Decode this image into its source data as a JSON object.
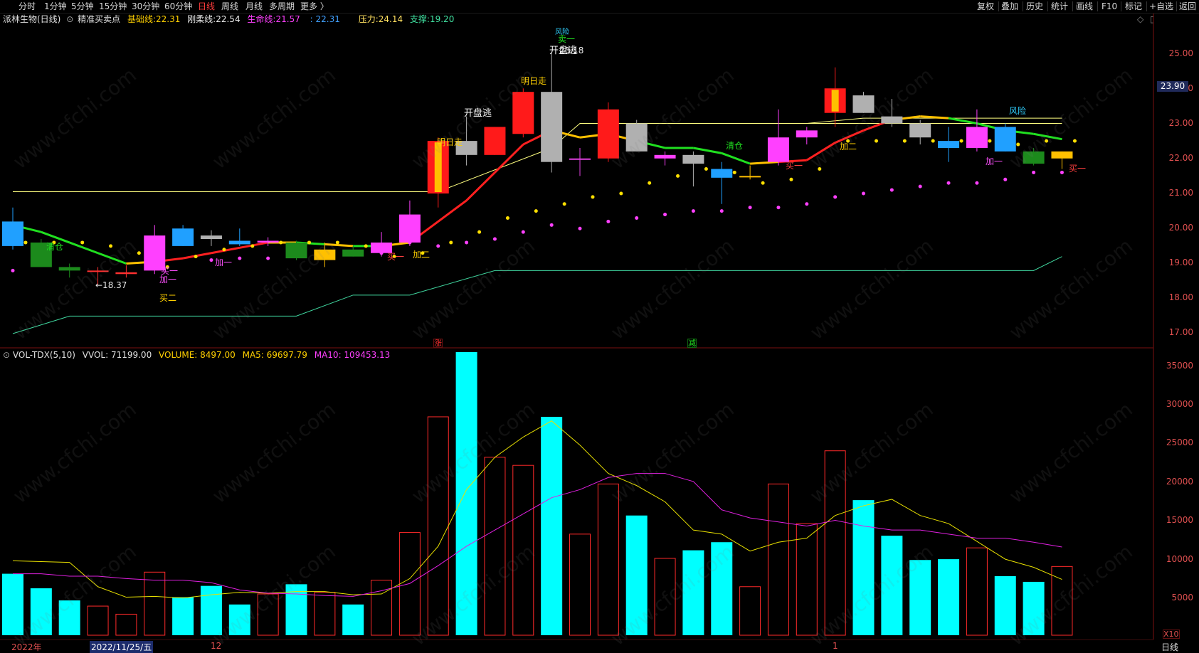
{
  "toolbar": {
    "periods": [
      "分时",
      "1分钟",
      "5分钟",
      "15分钟",
      "30分钟",
      "60分钟",
      "日线",
      "周线",
      "月线",
      "多周期",
      "更多 〉"
    ],
    "active_period": "日线",
    "right_buttons": [
      "复权",
      "叠加",
      "历史",
      "统计",
      "画线",
      "F10",
      "标记",
      "+自选",
      "返回"
    ]
  },
  "title": {
    "stock": "派林生物(日线)",
    "indicator": "精准买卖点",
    "base_label": "基础线:",
    "base_value": "22.31",
    "firm_label": "刚柔线:",
    "firm_value": "22.54",
    "life_label": "生命线:",
    "life_value": "21.57",
    "extra_value": ": 22.31",
    "pressure_label": "压力:",
    "pressure_value": "24.14",
    "support_label": "支撑:",
    "support_value": "19.20"
  },
  "vol_title": {
    "name": "VOL-TDX(5,10)",
    "vvol": "VVOL: 71199.00",
    "volume": "VOLUME: 8497.00",
    "ma5": "MA5: 69697.79",
    "ma10": "MA10: 109453.13"
  },
  "price_axis": [
    "25.00",
    "24.00",
    "23.00",
    "22.00",
    "21.00",
    "20.00",
    "19.00",
    "18.00",
    "17.00"
  ],
  "current_price_tag": "23.90",
  "vol_axis": [
    "35000",
    "30000",
    "25000",
    "20000",
    "15000",
    "10000",
    "5000"
  ],
  "vol_unit": "X10",
  "date_labels": [
    "2022年",
    "2022/11/25/五",
    "12",
    "1"
  ],
  "footer_right": "日线",
  "markers": {
    "zhang": "涨",
    "jian": "减",
    "low_price": "←18.37",
    "high_price": "23.18"
  },
  "annotations": [
    {
      "text": "清仓",
      "kind": "green"
    },
    {
      "text": "买二",
      "kind": "yellow"
    },
    {
      "text": "买一",
      "kind": "pink"
    },
    {
      "text": "加一",
      "kind": "pink"
    },
    {
      "text": "加一",
      "kind": "pink"
    },
    {
      "text": "买一",
      "kind": "pink"
    },
    {
      "text": "加二",
      "kind": "yellow"
    },
    {
      "text": "明日走",
      "kind": "yellow"
    },
    {
      "text": "开盘逃",
      "kind": "white"
    },
    {
      "text": "明日走",
      "kind": "yellow"
    },
    {
      "text": "开盘逃",
      "kind": "white"
    },
    {
      "text": "卖一",
      "kind": "green"
    },
    {
      "text": "风险",
      "kind": "cyan"
    },
    {
      "text": "清仓",
      "kind": "green"
    },
    {
      "text": "买一",
      "kind": "pink"
    },
    {
      "text": "加二",
      "kind": "yellow"
    },
    {
      "text": "风险",
      "kind": "cyan"
    },
    {
      "text": "加一",
      "kind": "pink"
    },
    {
      "text": "买一",
      "kind": "pink"
    }
  ],
  "watermark": "www.cfchi.com",
  "colors": {
    "up": "#ff2a2a",
    "down": "#00ffff",
    "ma5": "#e8e000",
    "ma10": "#e020e0",
    "support": "#40d8a0",
    "pressure": "#ffff80"
  },
  "chart_data": {
    "type": "candlestick",
    "ylim": [
      16.8,
      25.4
    ],
    "candles": [
      {
        "o": 20.2,
        "h": 20.6,
        "l": 19.4,
        "c": 19.5,
        "col": "#20a0ff"
      },
      {
        "o": 19.6,
        "h": 19.7,
        "l": 18.9,
        "c": 18.9,
        "col": "#1c8a1c"
      },
      {
        "o": 18.9,
        "h": 19.0,
        "l": 18.6,
        "c": 18.8,
        "col": "#1c8a1c"
      },
      {
        "o": 18.8,
        "h": 18.9,
        "l": 18.4,
        "c": 18.8,
        "col": "#ff3030"
      },
      {
        "o": 18.75,
        "h": 18.95,
        "l": 18.6,
        "c": 18.7,
        "col": "#ff3030"
      },
      {
        "o": 18.8,
        "h": 20.1,
        "l": 18.7,
        "c": 19.8,
        "col": "#ff40ff"
      },
      {
        "o": 20.0,
        "h": 20.1,
        "l": 19.5,
        "c": 19.5,
        "col": "#20a0ff"
      },
      {
        "o": 19.8,
        "h": 19.95,
        "l": 19.5,
        "c": 19.7,
        "col": "#b0b0b0"
      },
      {
        "o": 19.65,
        "h": 20.0,
        "l": 19.5,
        "c": 19.55,
        "col": "#20a0ff"
      },
      {
        "o": 19.6,
        "h": 19.75,
        "l": 19.5,
        "c": 19.65,
        "col": "#ff40ff"
      },
      {
        "o": 19.6,
        "h": 19.65,
        "l": 19.1,
        "c": 19.15,
        "col": "#1c8a1c"
      },
      {
        "o": 19.1,
        "h": 19.6,
        "l": 18.9,
        "c": 19.4,
        "col": "#ffc000"
      },
      {
        "o": 19.4,
        "h": 19.5,
        "l": 19.2,
        "c": 19.2,
        "col": "#1c8a1c"
      },
      {
        "o": 19.3,
        "h": 19.9,
        "l": 19.2,
        "c": 19.6,
        "col": "#ff40ff"
      },
      {
        "o": 19.6,
        "h": 20.8,
        "l": 19.5,
        "c": 20.4,
        "col": "#ff40ff"
      },
      {
        "o": 21.0,
        "h": 22.6,
        "l": 20.6,
        "c": 22.5,
        "col": "#ff1a1a",
        "inner": "#ffc000"
      },
      {
        "o": 22.5,
        "h": 23.2,
        "l": 21.8,
        "c": 22.1,
        "col": "#b0b0b0"
      },
      {
        "o": 22.1,
        "h": 22.9,
        "l": 22.1,
        "c": 22.9,
        "col": "#ff1a1a"
      },
      {
        "o": 22.7,
        "h": 24.0,
        "l": 22.6,
        "c": 23.9,
        "col": "#ff1a1a"
      },
      {
        "o": 23.9,
        "h": 25.0,
        "l": 21.6,
        "c": 21.9,
        "col": "#b0b0b0"
      },
      {
        "o": 22.0,
        "h": 22.3,
        "l": 21.5,
        "c": 22.0,
        "col": "#e040e0"
      },
      {
        "o": 23.4,
        "h": 23.6,
        "l": 21.9,
        "c": 22.0,
        "col": "#ff1a1a"
      },
      {
        "o": 23.0,
        "h": 23.1,
        "l": 22.2,
        "c": 22.2,
        "col": "#b0b0b0"
      },
      {
        "o": 22.1,
        "h": 22.2,
        "l": 21.8,
        "c": 22.0,
        "col": "#ff40ff"
      },
      {
        "o": 22.1,
        "h": 22.2,
        "l": 21.2,
        "c": 21.85,
        "col": "#b0b0b0"
      },
      {
        "o": 21.7,
        "h": 21.9,
        "l": 20.7,
        "c": 21.45,
        "col": "#20a0ff"
      },
      {
        "o": 21.5,
        "h": 21.8,
        "l": 21.4,
        "c": 21.5,
        "col": "#ffc000"
      },
      {
        "o": 21.9,
        "h": 23.4,
        "l": 21.8,
        "c": 22.6,
        "col": "#ff40ff"
      },
      {
        "o": 22.6,
        "h": 22.9,
        "l": 22.4,
        "c": 22.8,
        "col": "#ff40ff"
      },
      {
        "o": 23.3,
        "h": 24.6,
        "l": 22.9,
        "c": 24.0,
        "col": "#ff1a1a",
        "inner": "#ffc000"
      },
      {
        "o": 23.8,
        "h": 23.9,
        "l": 23.3,
        "c": 23.3,
        "col": "#b0b0b0"
      },
      {
        "o": 23.2,
        "h": 23.7,
        "l": 22.9,
        "c": 23.0,
        "col": "#b0b0b0"
      },
      {
        "o": 23.0,
        "h": 23.1,
        "l": 22.4,
        "c": 22.6,
        "col": "#b0b0b0"
      },
      {
        "o": 22.5,
        "h": 22.9,
        "l": 21.9,
        "c": 22.3,
        "col": "#20a0ff"
      },
      {
        "o": 22.3,
        "h": 23.4,
        "l": 22.2,
        "c": 22.9,
        "col": "#ff40ff"
      },
      {
        "o": 22.9,
        "h": 23.0,
        "l": 22.2,
        "c": 22.2,
        "col": "#20a0ff"
      },
      {
        "o": 22.2,
        "h": 22.3,
        "l": 21.8,
        "c": 21.85,
        "col": "#1c8a1c"
      },
      {
        "o": 22.0,
        "h": 22.2,
        "l": 21.7,
        "c": 22.2,
        "col": "#ffc000"
      }
    ],
    "volumes": [
      7600,
      5800,
      4300,
      3600,
      2600,
      7800,
      4700,
      6100,
      3800,
      5100,
      6300,
      5300,
      3800,
      6800,
      12700,
      27000,
      35000,
      22000,
      21000,
      27000,
      12500,
      18700,
      14800,
      9500,
      10500,
      11500,
      6000,
      18700,
      13800,
      22800,
      16700,
      12300,
      9300,
      9400,
      10800,
      7300,
      6600,
      8500
    ],
    "vol_up": [
      false,
      false,
      false,
      true,
      true,
      true,
      false,
      false,
      false,
      true,
      false,
      true,
      false,
      true,
      true,
      true,
      false,
      true,
      true,
      false,
      true,
      true,
      false,
      true,
      false,
      false,
      true,
      true,
      true,
      true,
      false,
      false,
      false,
      false,
      true,
      false,
      false,
      true
    ],
    "vol_ma5": [
      9200,
      9100,
      9000,
      6000,
      4700,
      4800,
      4600,
      5000,
      5300,
      5200,
      5400,
      5400,
      5000,
      5100,
      7000,
      11000,
      18000,
      22000,
      24500,
      26500,
      23500,
      20000,
      18500,
      16500,
      13000,
      12500,
      10400,
      11500,
      12000,
      14800,
      16000,
      16800,
      14800,
      13800,
      11600,
      9400,
      8400,
      6900
    ],
    "vol_ma10": [
      7600,
      7600,
      7300,
      7300,
      7000,
      6800,
      6800,
      6500,
      5600,
      5200,
      5100,
      4900,
      4800,
      5500,
      6400,
      8600,
      11000,
      13000,
      15000,
      17000,
      18000,
      19500,
      20000,
      20000,
      19000,
      15500,
      14500,
      14000,
      13500,
      14200,
      13500,
      13000,
      13000,
      12500,
      12000,
      12000,
      11500,
      10900
    ],
    "base_line": [
      20.1,
      19.9,
      19.6,
      19.3,
      19.0,
      19.05,
      19.15,
      19.3,
      19.45,
      19.6,
      19.6,
      19.55,
      19.5,
      19.5,
      19.6,
      20.2,
      20.8,
      21.6,
      22.4,
      22.8,
      22.6,
      22.7,
      22.5,
      22.3,
      22.3,
      22.15,
      21.85,
      21.9,
      21.95,
      22.45,
      22.8,
      23.1,
      23.2,
      23.15,
      23.0,
      22.8,
      22.7,
      22.55
    ],
    "line_colors": [
      "#20e020",
      "#20e020",
      "#20e020",
      "#20e020",
      "#ffc000",
      "#ff2020",
      "#ff2020",
      "#ff2020",
      "#ff2020",
      "#ffc000",
      "#20e020",
      "#ffc000",
      "#20e020",
      "#ffc000",
      "#ff2020",
      "#ff2020",
      "#ff2020",
      "#ff2020",
      "#ff2020",
      "#ffc000",
      "#ffc000",
      "#ffc000",
      "#20e020",
      "#20e020",
      "#20e020",
      "#20e020",
      "#ffc000",
      "#ff2020",
      "#ff2020",
      "#ff2020",
      "#ff2020",
      "#ffc000",
      "#ffc000",
      "#20e020",
      "#20e020",
      "#20e020",
      "#20e020",
      "#ffc000"
    ],
    "pressure_steps": [
      [
        0,
        21.05
      ],
      [
        14,
        21.05
      ],
      [
        15,
        21.05
      ],
      [
        19,
        22.3
      ],
      [
        20,
        23.0
      ],
      [
        37,
        23.0
      ]
    ],
    "pressure2": [
      [
        28,
        23.0
      ],
      [
        30,
        23.15
      ],
      [
        37,
        23.15
      ]
    ],
    "support_steps": [
      [
        0,
        17.0
      ],
      [
        2,
        17.5
      ],
      [
        10,
        17.5
      ],
      [
        12,
        18.1
      ],
      [
        14,
        18.1
      ],
      [
        17,
        18.8
      ],
      [
        36,
        18.8
      ],
      [
        37,
        19.2
      ]
    ],
    "yellow_dots": [
      19.6,
      19.6,
      19.6,
      19.5,
      19.3,
      18.9,
      19.2,
      19.4,
      19.5,
      19.6,
      19.6,
      19.6,
      19.5,
      19.2,
      19.3,
      19.6,
      19.9,
      20.3,
      20.5,
      20.7,
      20.9,
      21.0,
      21.3,
      21.5,
      21.7,
      21.6,
      21.3,
      21.4,
      21.7,
      22.5,
      22.5,
      22.5,
      22.5,
      22.5,
      22.5,
      22.4,
      22.5,
      22.5
    ],
    "pink_dots": [
      18.8,
      null,
      null,
      null,
      null,
      18.9,
      null,
      19.1,
      19.15,
      19.15,
      19.2,
      null,
      null,
      19.3,
      19.6,
      19.5,
      19.6,
      19.7,
      19.9,
      20.1,
      20.0,
      20.2,
      20.3,
      20.4,
      20.5,
      20.5,
      20.6,
      20.6,
      20.7,
      20.9,
      21.0,
      21.1,
      21.2,
      21.3,
      21.3,
      21.4,
      21.6,
      21.6
    ]
  }
}
